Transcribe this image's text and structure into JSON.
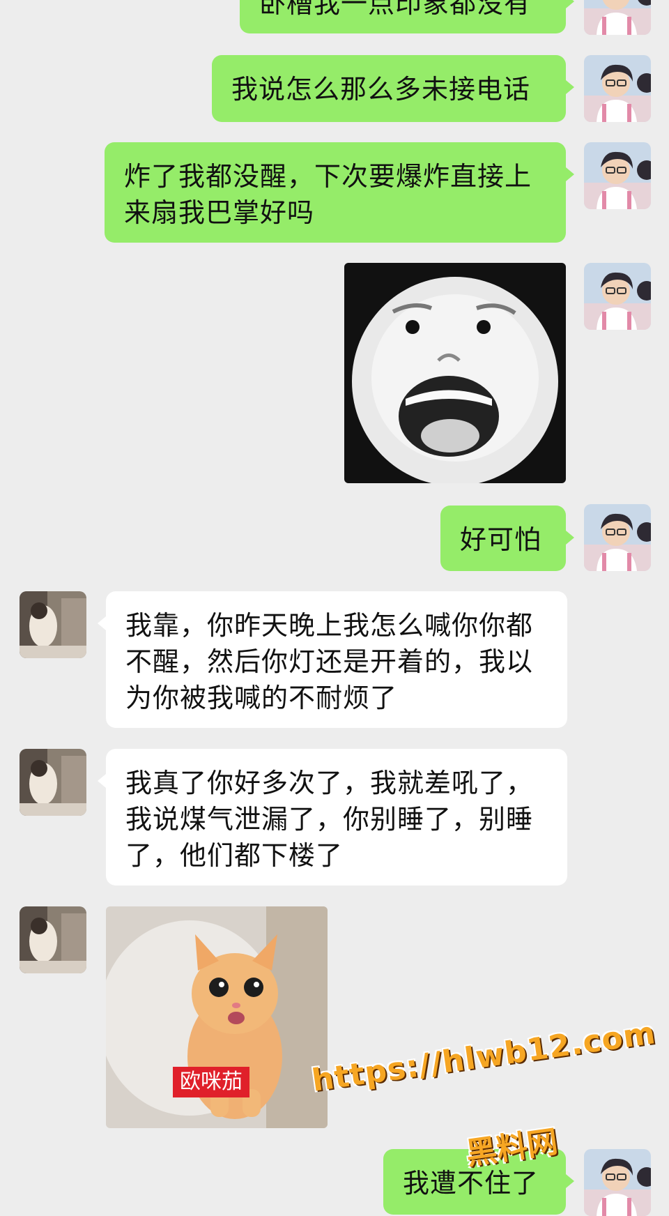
{
  "chat": {
    "messages": [
      {
        "sender": "me",
        "type": "text",
        "text": "卧槽我一点印象都没有"
      },
      {
        "sender": "me",
        "type": "text",
        "text": "我说怎么那么多未接电话"
      },
      {
        "sender": "me",
        "type": "text",
        "text": "炸了我都没醒，下次要爆炸直接上来扇我巴掌好吗"
      },
      {
        "sender": "me",
        "type": "sticker",
        "description": "screaming-face-meme"
      },
      {
        "sender": "me",
        "type": "text",
        "text": "好可怕"
      },
      {
        "sender": "them",
        "type": "text",
        "text": "我靠，你昨天晚上我怎么喊你你都不醒，然后你灯还是开着的，我以为你被我喊的不耐烦了"
      },
      {
        "sender": "them",
        "type": "text",
        "text": "我真了你好多次了，我就差吼了，我说煤气泄漏了，你别睡了，别睡了，他们都下楼了"
      },
      {
        "sender": "them",
        "type": "sticker",
        "description": "kitten-meme",
        "caption": "欧咪茄"
      },
      {
        "sender": "me",
        "type": "text",
        "text": "我遭不住了"
      }
    ]
  },
  "watermark": {
    "url": "https://hlwb12.com",
    "site_name": "黑料网"
  },
  "colors": {
    "background": "#ededed",
    "my_bubble": "#95ec69",
    "their_bubble": "#ffffff",
    "watermark": "#f6a623"
  }
}
